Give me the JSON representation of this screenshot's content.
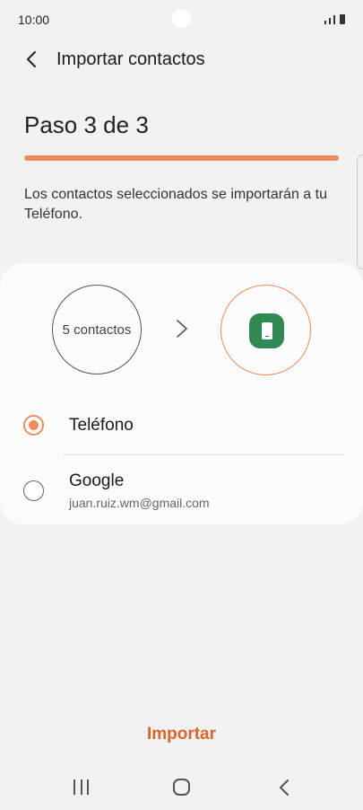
{
  "status_bar": {
    "time": "10:00"
  },
  "header": {
    "title": "Importar contactos"
  },
  "step": {
    "title": "Paso 3 de 3",
    "progress": 1.0
  },
  "description": "Los contactos seleccionados se importarán a tu Teléfono.",
  "transfer": {
    "source_label": "5 contactos",
    "destination_icon": "phone-icon"
  },
  "options": [
    {
      "label": "Teléfono",
      "selected": true
    },
    {
      "label": "Google",
      "account": "juan.ruiz.wm@gmail.com",
      "selected": false
    }
  ],
  "action": {
    "import_label": "Importar"
  },
  "colors": {
    "accent": "#eb8c5a",
    "button_text": "#d9652c",
    "phone_badge": "#2e8a52",
    "background": "#f2f2f2"
  }
}
